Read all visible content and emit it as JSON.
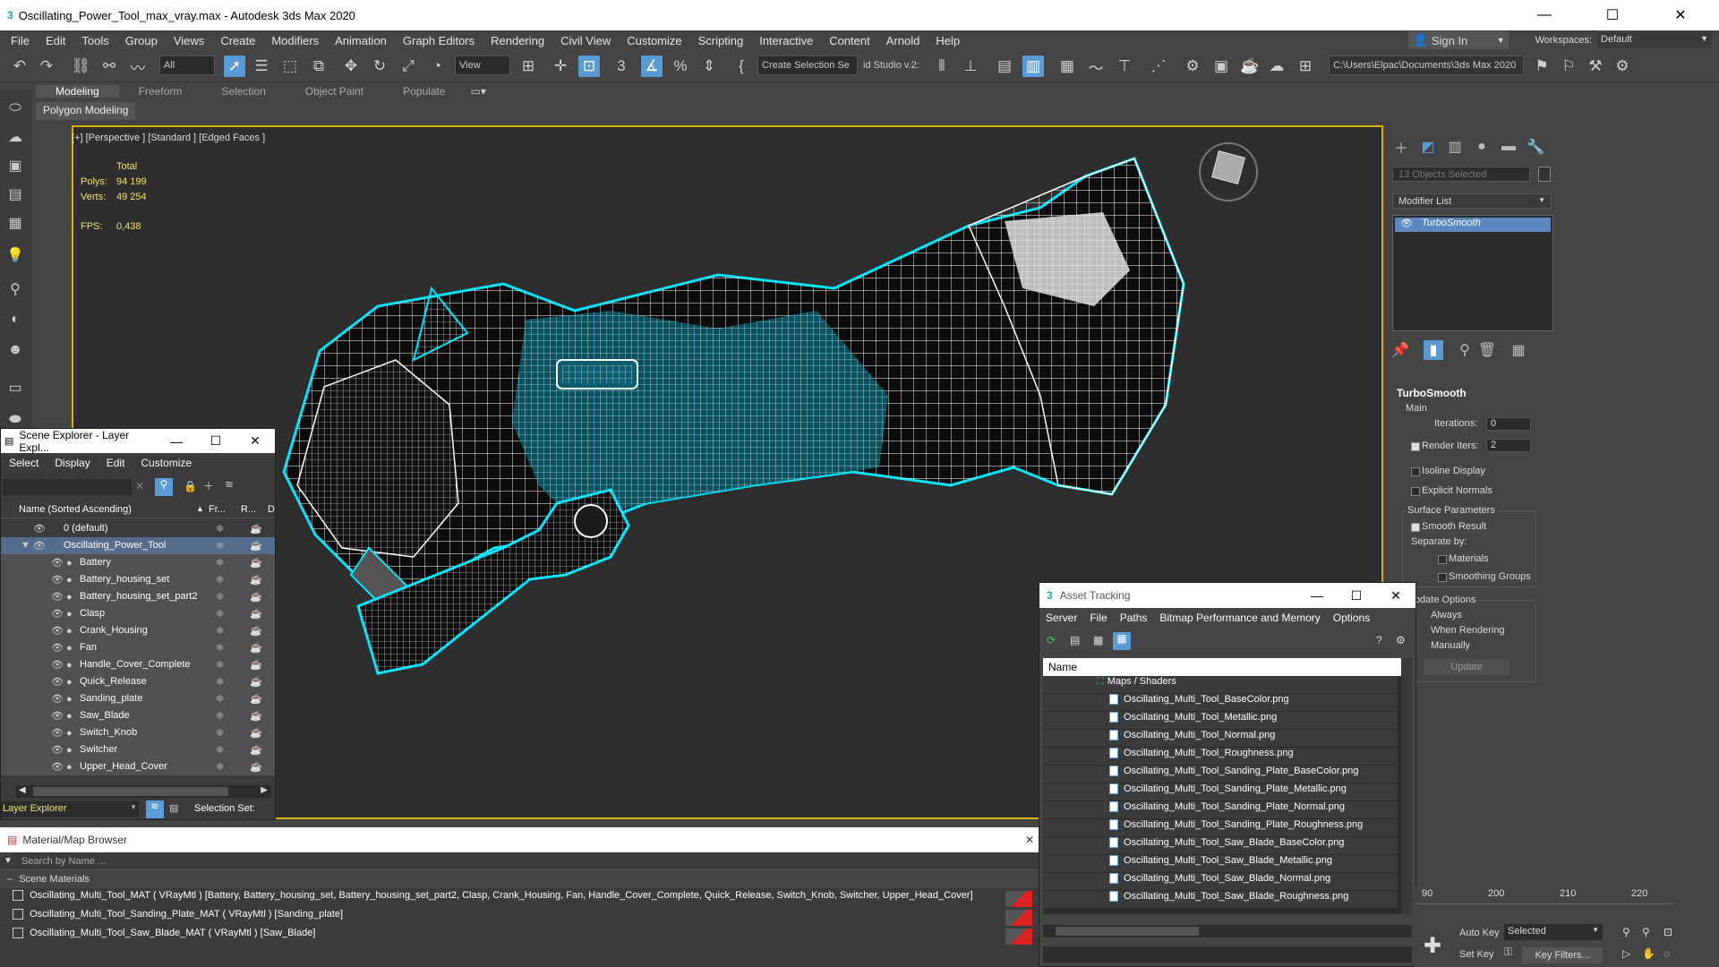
{
  "window": {
    "title": "Oscillating_Power_Tool_max_vray.max - Autodesk 3ds Max 2020",
    "min": "—",
    "max": "☐",
    "close": "✕"
  },
  "menu": [
    "File",
    "Edit",
    "Tools",
    "Group",
    "Views",
    "Create",
    "Modifiers",
    "Animation",
    "Graph Editors",
    "Rendering",
    "Civil View",
    "Customize",
    "Scripting",
    "Interactive",
    "Content",
    "Arnold",
    "Help"
  ],
  "signin": "Sign In",
  "workspaces_label": "Workspaces:",
  "workspaces_value": "Default",
  "toolbar": {
    "filter": "All",
    "view": "View",
    "create_selection_set": "Create Selection Se",
    "studio": "id Studio v.2:",
    "path": "C:\\Users\\Elpac\\Documents\\3ds Max 2020"
  },
  "ribbon": {
    "tabs": [
      "Modeling",
      "Freeform",
      "Selection",
      "Object Paint",
      "Populate"
    ],
    "sub": "Polygon Modeling"
  },
  "viewport": {
    "label": "[+] [Perspective ] [Standard ] [Edged Faces ]",
    "stats": {
      "total": "Total",
      "polys_label": "Polys:",
      "polys": "94 199",
      "verts_label": "Verts:",
      "verts": "49 254",
      "fps_label": "FPS:",
      "fps": "0,438"
    }
  },
  "command_panel": {
    "selected": "13 Objects Selected",
    "modifier_list": "Modifier List",
    "modifier": "TurboSmooth",
    "turbosmooth": {
      "title": "TurboSmooth",
      "main": "Main",
      "iterations_label": "Iterations:",
      "iterations": "0",
      "render_iters_label": "Render Iters:",
      "render_iters": "2",
      "isoline": "Isoline Display",
      "explicit": "Explicit Normals",
      "surface": "Surface Parameters",
      "smooth_result": "Smooth Result",
      "separate_by": "Separate by:",
      "materials": "Materials",
      "smoothing_groups": "Smoothing Groups",
      "update_options": "Update Options",
      "always": "Always",
      "when_rendering": "When Rendering",
      "manually": "Manually",
      "update": "Update"
    }
  },
  "scene_explorer": {
    "title": "Scene Explorer - Layer Expl...",
    "menu": [
      "Select",
      "Display",
      "Edit",
      "Customize"
    ],
    "col_name": "Name (Sorted Ascending)",
    "col_fr": "Fr...",
    "col_r": "R...",
    "col_d": "D",
    "default_layer": "0 (default)",
    "root": "Oscillating_Power_Tool",
    "items": [
      "Battery",
      "Battery_housing_set",
      "Battery_housing_set_part2",
      "Clasp",
      "Crank_Housing",
      "Fan",
      "Handle_Cover_Complete",
      "Quick_Release",
      "Sanding_plate",
      "Saw_Blade",
      "Switch_Knob",
      "Switcher",
      "Upper_Head_Cover"
    ],
    "footer_explorer": "Layer Explorer",
    "footer_selset": "Selection Set:"
  },
  "material_browser": {
    "title": "Material/Map Browser",
    "search": "Search by Name ...",
    "section": "Scene Materials",
    "items": [
      "Oscillating_Multi_Tool_MAT ( VRayMtl ) [Battery, Battery_housing_set, Battery_housing_set_part2, Clasp, Crank_Housing, Fan, Handle_Cover_Complete, Quick_Release, Switch_Knob, Switcher, Upper_Head_Cover]",
      "Oscillating_Multi_Tool_Sanding_Plate_MAT ( VRayMtl ) [Sanding_plate]",
      "Oscillating_Multi_Tool_Saw_Blade_MAT ( VRayMtl ) [Saw_Blade]"
    ]
  },
  "asset_tracking": {
    "title": "Asset Tracking",
    "menu": [
      "Server",
      "File",
      "Paths",
      "Bitmap Performance and Memory",
      "Options"
    ],
    "col_name": "Name",
    "group": "Maps / Shaders",
    "files": [
      "Oscillating_Multi_Tool_BaseColor.png",
      "Oscillating_Multi_Tool_Metallic.png",
      "Oscillating_Multi_Tool_Normal.png",
      "Oscillating_Multi_Tool_Roughness.png",
      "Oscillating_Multi_Tool_Sanding_Plate_BaseColor.png",
      "Oscillating_Multi_Tool_Sanding_Plate_Metallic.png",
      "Oscillating_Multi_Tool_Sanding_Plate_Normal.png",
      "Oscillating_Multi_Tool_Sanding_Plate_Roughness.png",
      "Oscillating_Multi_Tool_Saw_Blade_BaseColor.png",
      "Oscillating_Multi_Tool_Saw_Blade_Metallic.png",
      "Oscillating_Multi_Tool_Saw_Blade_Normal.png",
      "Oscillating_Multi_Tool_Saw_Blade_Roughness.png"
    ]
  },
  "timeline": {
    "ticks": [
      "90",
      "200",
      "210",
      "220"
    ],
    "auto_key": "Auto Key",
    "selected": "Selected",
    "set_key": "Set Key",
    "key_filters": "Key Filters..."
  }
}
